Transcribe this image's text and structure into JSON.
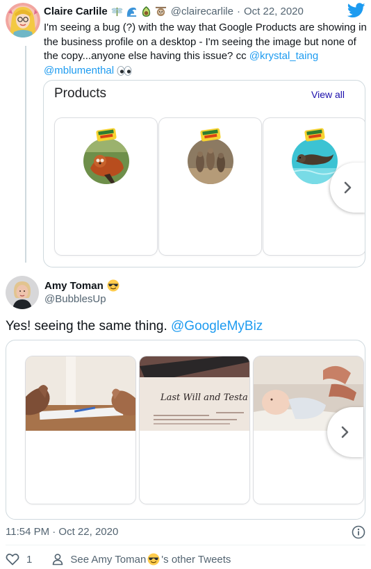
{
  "tweet1": {
    "display_name": "Claire Carlile",
    "name_emojis": [
      "dragonfly-icon",
      "wave-icon",
      "avocado-icon",
      "sloth-icon"
    ],
    "handle": "@clairecarlile",
    "separator": "·",
    "date": "Oct 22, 2020",
    "text_line1": "I'm seeing a bug (?) with the way that Google Products are showing in",
    "text_line2": "the business profile on a desktop - I'm seeing the image but none of",
    "text_line3_prefix": "the copy...anyone else having this issue? cc ",
    "mention1": "@krystal_taing",
    "mention2": "@mblumenthal",
    "trailing_emoji": "eyes-icon"
  },
  "card1": {
    "title": "Products",
    "view_all": "View all",
    "products": [
      {
        "icon": "red-panda-product-image"
      },
      {
        "icon": "meerkats-product-image"
      },
      {
        "icon": "otter-product-image"
      }
    ]
  },
  "tweet2": {
    "display_name": "Amy Toman",
    "name_emoji": "sunglasses-face-icon",
    "handle": "@BubblesUp",
    "text_prefix": "Yes! seeing the same thing. ",
    "mention": "@GoogleMyBiz",
    "timestamp": "11:54 PM · Oct 22, 2020",
    "like_count": "1",
    "other_tweets_prefix": "See Amy Toman ",
    "other_tweets_suffix": "'s other Tweets"
  },
  "card2": {
    "products": [
      {
        "icon": "clasped-hands-image"
      },
      {
        "icon": "last-will-document-image",
        "image_text": "Last Will and Testa"
      },
      {
        "icon": "baby-image"
      }
    ]
  },
  "colors": {
    "link": "#1d9bf0",
    "muted": "#536471",
    "twitter_blue": "#1d9bf0",
    "google_link": "#1a0dab"
  }
}
